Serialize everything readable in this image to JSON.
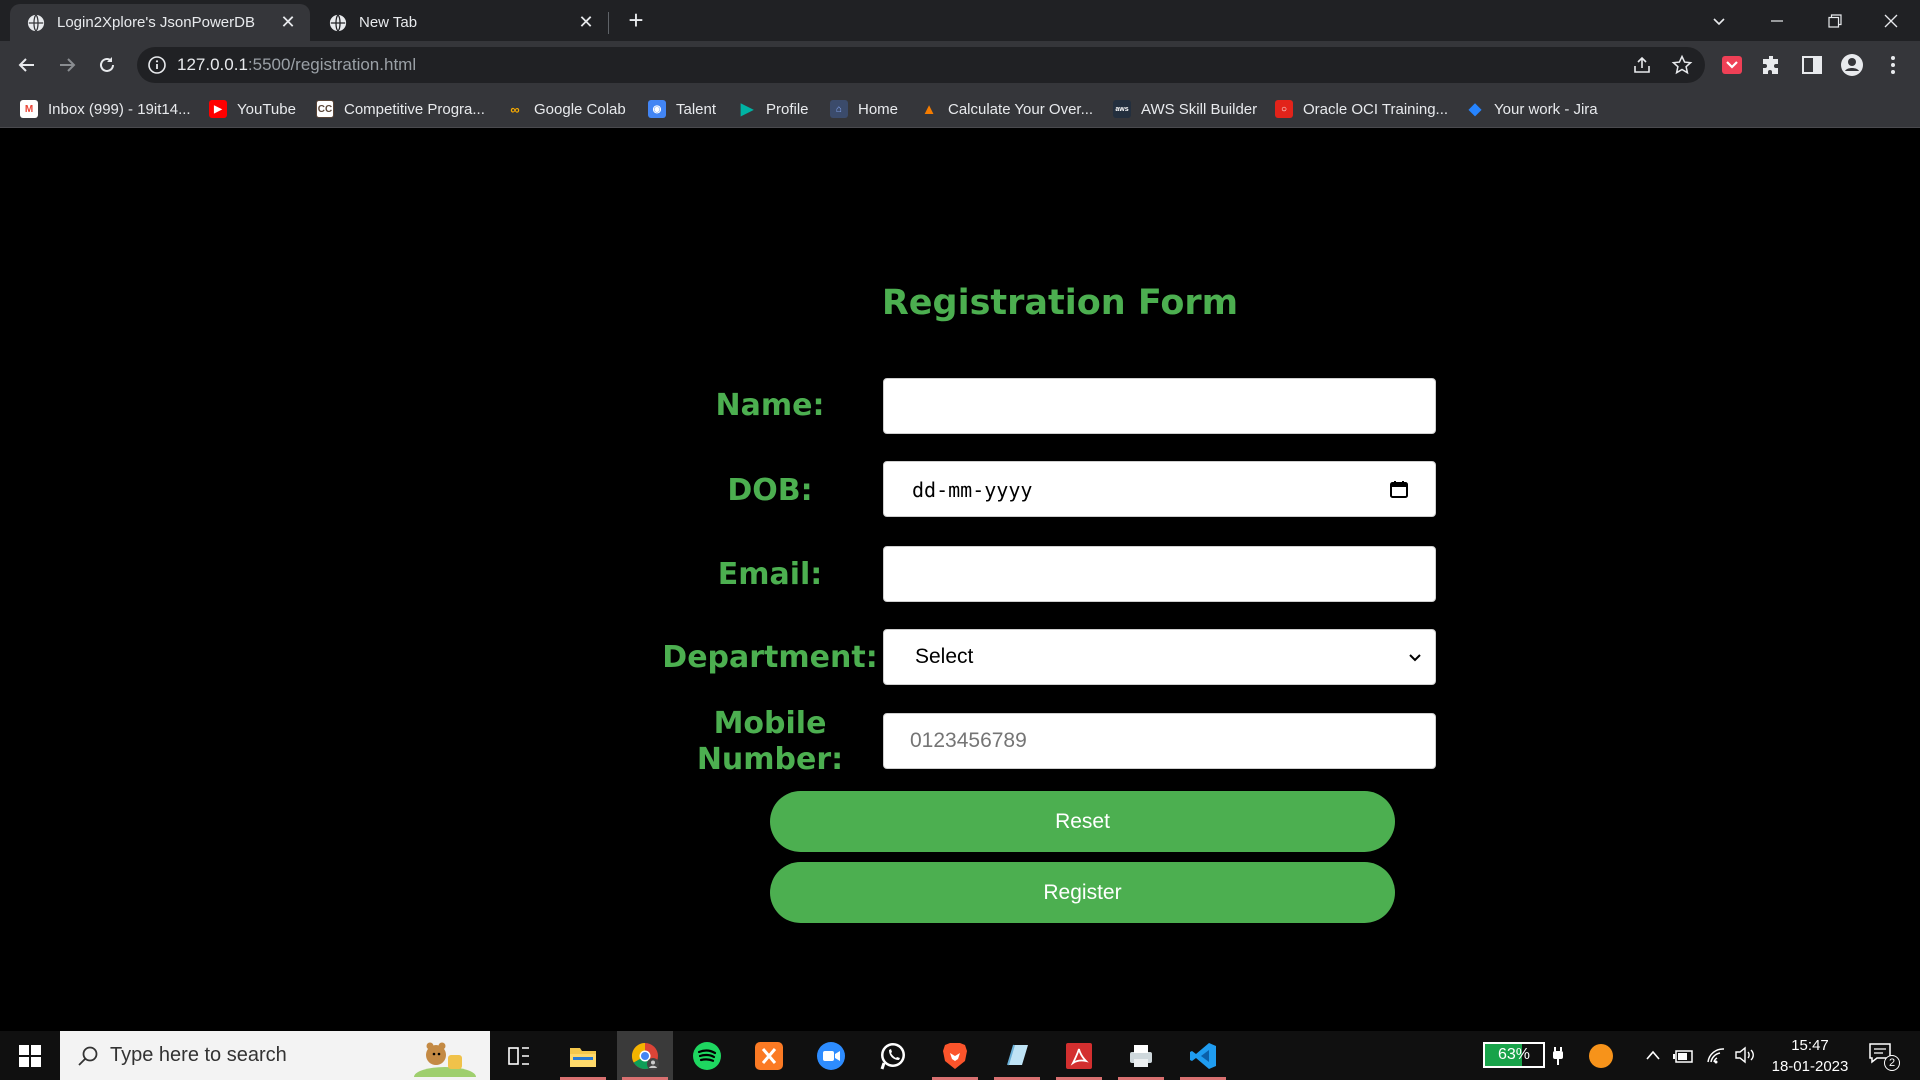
{
  "browser": {
    "tabs": [
      {
        "title": "Login2Xplore's JsonPowerDB",
        "active": true
      },
      {
        "title": "New Tab",
        "active": false
      }
    ],
    "url_host": "127.0.0.1",
    "url_path": ":5500/registration.html",
    "bookmarks": [
      {
        "label": "Inbox (999) - 19it14...",
        "icon": "gmail-icon",
        "color": "#ea4335"
      },
      {
        "label": "YouTube",
        "icon": "youtube-icon",
        "color": "#ff0000"
      },
      {
        "label": "Competitive Progra...",
        "icon": "codechef-icon",
        "color": "#5b4638"
      },
      {
        "label": "Google Colab",
        "icon": "colab-icon",
        "color": "#f9ab00"
      },
      {
        "label": "Talent",
        "icon": "talent-icon",
        "color": "#4285f4"
      },
      {
        "label": "Profile",
        "icon": "profile-icon",
        "color": "#00b3a4"
      },
      {
        "label": "Home",
        "icon": "home-icon",
        "color": "#5a7fd6"
      },
      {
        "label": "Calculate Your Over...",
        "icon": "calculate-icon",
        "color": "#f57c00"
      },
      {
        "label": "AWS Skill Builder",
        "icon": "aws-icon",
        "color": "#232f3e"
      },
      {
        "label": "Oracle OCI Training...",
        "icon": "oracle-icon",
        "color": "#e2231a"
      },
      {
        "label": "Your work - Jira",
        "icon": "jira-icon",
        "color": "#2684ff"
      }
    ]
  },
  "form": {
    "title": "Registration Form",
    "name_label": "Name:",
    "dob_label": "DOB:",
    "dob_placeholder": "dd-mm-yyyy",
    "email_label": "Email:",
    "department_label": "Department:",
    "department_selected": "Select",
    "mobile_label_line1": "Mobile",
    "mobile_label_line2": "Number:",
    "mobile_placeholder": "0123456789",
    "reset_label": "Reset",
    "register_label": "Register",
    "accent_color": "#4caf50"
  },
  "taskbar": {
    "search_placeholder": "Type here to search",
    "battery_percent": "63%",
    "battery_level": 0.63,
    "time": "15:47",
    "date": "18-01-2023",
    "notification_count": "2"
  }
}
